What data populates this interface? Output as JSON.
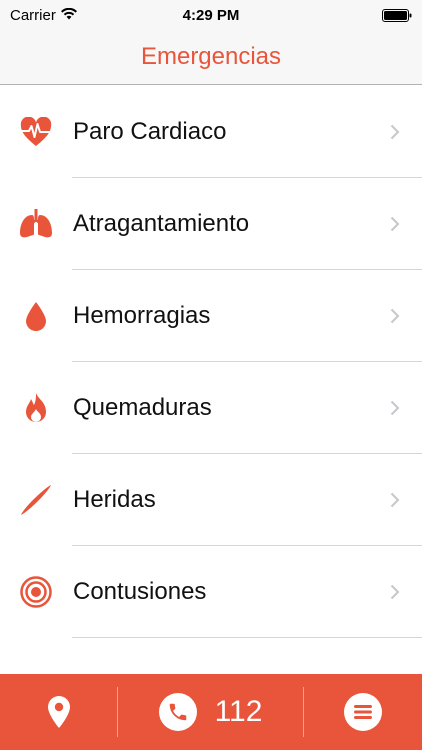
{
  "status_bar": {
    "carrier": "Carrier",
    "time": "4:29 PM"
  },
  "nav": {
    "title": "Emergencias"
  },
  "list": [
    {
      "label": "Paro Cardiaco",
      "icon": "heart-pulse-icon"
    },
    {
      "label": "Atragantamiento",
      "icon": "lungs-icon"
    },
    {
      "label": "Hemorragias",
      "icon": "blood-drop-icon"
    },
    {
      "label": "Quemaduras",
      "icon": "flame-icon"
    },
    {
      "label": "Heridas",
      "icon": "cut-icon"
    },
    {
      "label": "Contusiones",
      "icon": "target-icon"
    }
  ],
  "tab_bar": {
    "call_number": "112"
  },
  "colors": {
    "accent": "#e8553a"
  }
}
